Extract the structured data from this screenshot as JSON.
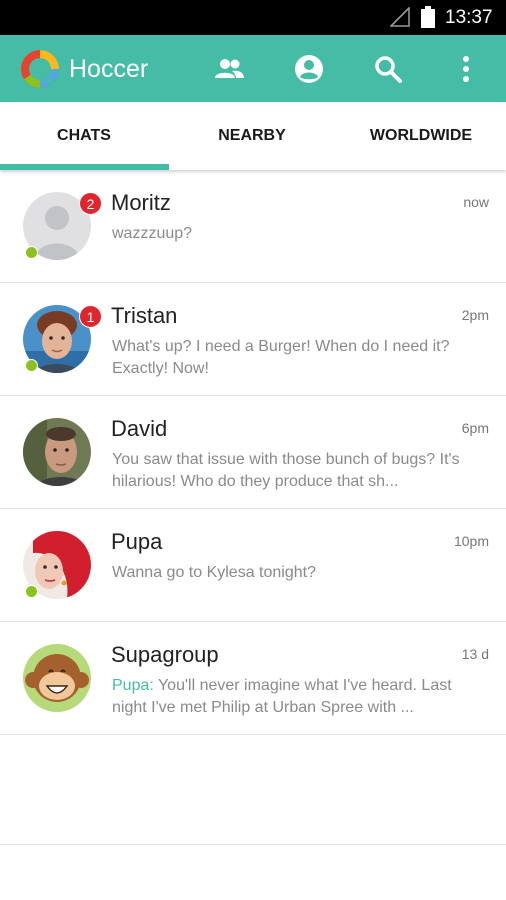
{
  "status_bar": {
    "time": "13:37"
  },
  "app_bar": {
    "title": "Hoccer",
    "icons": [
      "contacts-icon",
      "profile-icon",
      "search-icon",
      "more-vert-icon"
    ]
  },
  "tabs": [
    {
      "label": "CHATS",
      "selected": true
    },
    {
      "label": "NEARBY",
      "selected": false
    },
    {
      "label": "WORLDWIDE",
      "selected": false
    }
  ],
  "colors": {
    "accent": "#45bca6",
    "badge": "#e0262d",
    "online": "#8bc21f"
  },
  "chats": [
    {
      "name": "Moritz",
      "time": "now",
      "sender": "",
      "preview": "wazzzuup?",
      "unread": "2",
      "online": true
    },
    {
      "name": "Tristan",
      "time": "2pm",
      "sender": "",
      "preview": "What's up? I need a Burger! When do I need it? Exactly! Now!",
      "unread": "1",
      "online": true
    },
    {
      "name": "David",
      "time": "6pm",
      "sender": "",
      "preview": "You saw that issue with those bunch of bugs? It's hilarious! Who do they produce that sh...",
      "unread": "",
      "online": false
    },
    {
      "name": "Pupa",
      "time": "10pm",
      "sender": "",
      "preview": "Wanna go to Kylesa tonight?",
      "unread": "",
      "online": true
    },
    {
      "name": "Supagroup",
      "time": "13 d",
      "sender": "Pupa:",
      "preview": "You'll never imagine what I've heard. Last night I've met Philip at Urban Spree with ...",
      "unread": "",
      "online": false
    }
  ]
}
